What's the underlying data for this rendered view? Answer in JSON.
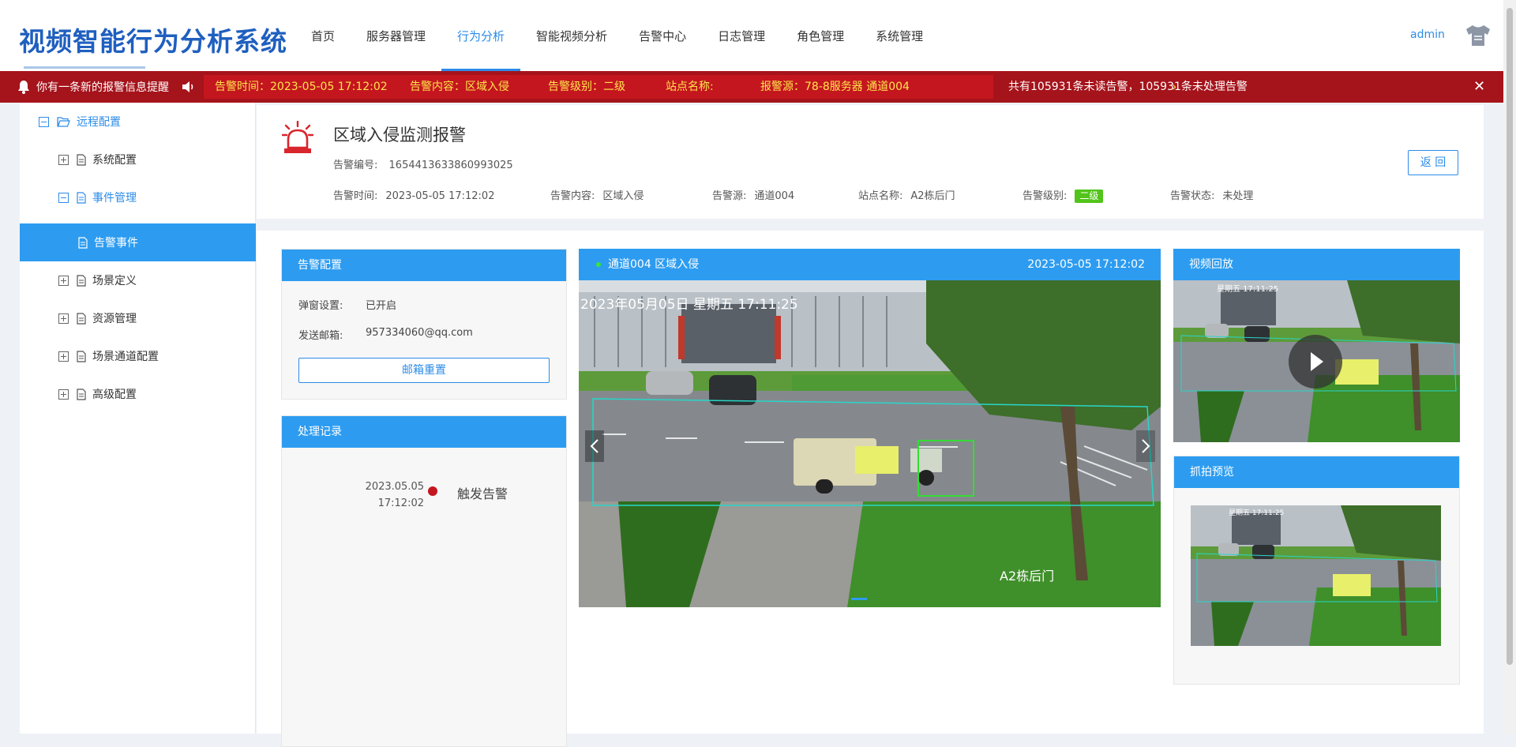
{
  "brand": "视频智能行为分析系统",
  "nav": [
    "首页",
    "服务器管理",
    "行为分析",
    "智能视频分析",
    "告警中心",
    "日志管理",
    "角色管理",
    "系统管理"
  ],
  "user": "admin",
  "alert": {
    "lead": "你有一条新的报警信息提醒",
    "time": "告警时间：2023-05-05 17:12:02",
    "content": "告警内容：区域入侵",
    "level": "告警级别：二级",
    "site": "站点名称:",
    "source": "报警源：78-8服务器 通道004",
    "summary": "共有105931条未读告警，105931条未处理告警"
  },
  "sidebar": [
    {
      "label": "远程配置"
    },
    {
      "label": "系统配置"
    },
    {
      "label": "事件管理"
    },
    {
      "label": "告警事件"
    },
    {
      "label": "场景定义"
    },
    {
      "label": "资源管理"
    },
    {
      "label": "场景通道配置"
    },
    {
      "label": "高级配置"
    }
  ],
  "detail": {
    "title": "区域入侵监测报警",
    "number_label": "告警编号:",
    "number": "1654413633860993025",
    "fields": [
      {
        "key": "告警时间:",
        "val": "2023-05-05 17:12:02"
      },
      {
        "key": "告警内容:",
        "val": "区域入侵"
      },
      {
        "key": "告警源:",
        "val": "通道004"
      },
      {
        "key": "站点名称:",
        "val": "A2栋后门"
      },
      {
        "key": "告警级别:",
        "val": "二级"
      },
      {
        "key": "告警状态:",
        "val": "未处理"
      }
    ],
    "back": "返 回"
  },
  "config": {
    "title": "告警配置",
    "popup_label": "弹窗设置:",
    "popup_value": "已开启",
    "email_label": "发送邮箱:",
    "email_value": "957334060@qq.com",
    "reset": "邮箱重置"
  },
  "records": {
    "title": "处理记录",
    "date": "2023.05.05",
    "time": "17:12:02",
    "action": "触发告警"
  },
  "video": {
    "channel": "通道004 区域入侵",
    "timestamp": "2023-05-05 17:12:02",
    "overlay_time": "2023年05月05日  星期五  17:11:25",
    "overlay_site": "A2栋后门"
  },
  "playback": {
    "title": "视频回放",
    "overlay_time": "星期五  17:11:25"
  },
  "snapshot": {
    "title": "抓拍预览",
    "overlay_time": "星期五  17:11:25"
  },
  "colors": {
    "accent": "#2d9cf0",
    "alert_bar": "#a5131b",
    "alert_text": "#ffe44d",
    "level_badge": "#52c41a"
  }
}
